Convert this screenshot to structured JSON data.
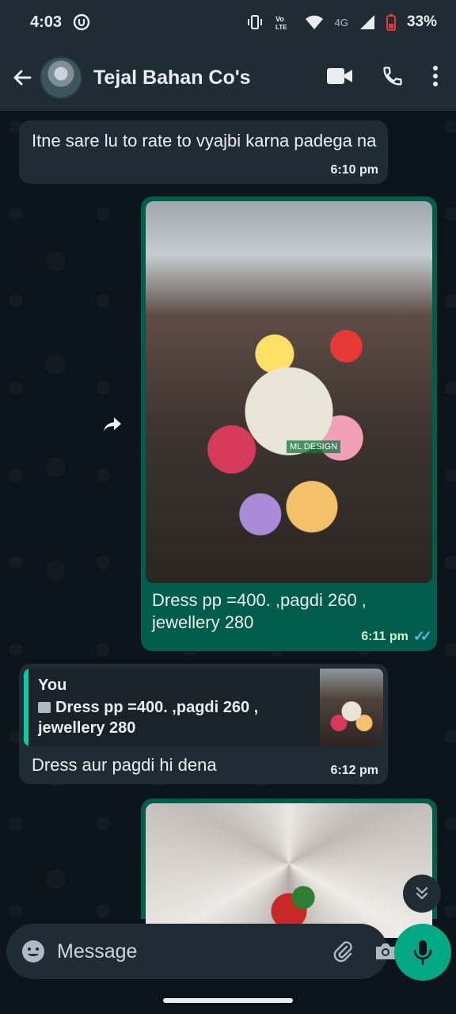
{
  "status_bar": {
    "time": "4:03",
    "network": "4G",
    "battery": "33%"
  },
  "header": {
    "contact_name": "Tejal Bahan Co's"
  },
  "messages": [
    {
      "direction": "in",
      "text": "Itne sare lu to rate to vyajbi karna padega na",
      "time": "6:10 pm"
    },
    {
      "direction": "out",
      "type": "image",
      "watermark": "ML DESIGN",
      "caption": "Dress pp =400.  ,pagdi 260 , jewellery 280",
      "time": "6:11 pm",
      "status": "read"
    },
    {
      "direction": "in",
      "quote": {
        "author": "You",
        "text": "Dress pp =400.  ,pagdi 260 , jewellery 280"
      },
      "text": "Dress aur pagdi hi dena",
      "time": "6:12 pm"
    },
    {
      "direction": "out",
      "type": "image"
    }
  ],
  "composer": {
    "placeholder": "Message"
  },
  "colors": {
    "incoming_bubble": "#202c33",
    "outgoing_bubble": "#005c4b",
    "accent": "#00a884",
    "read_tick": "#53bdeb"
  }
}
